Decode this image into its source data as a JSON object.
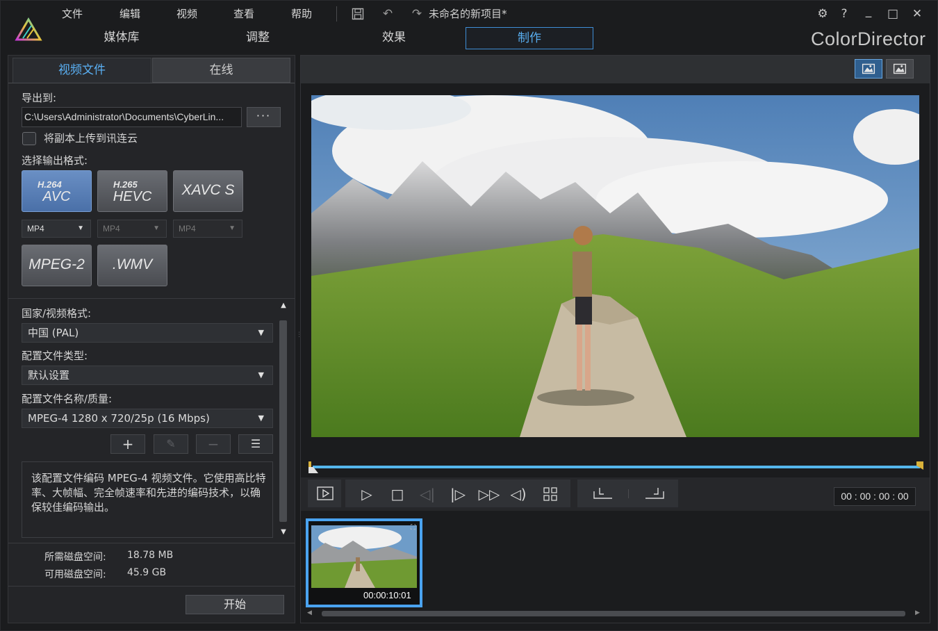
{
  "menu": [
    "文件",
    "编辑",
    "视频",
    "查看",
    "帮助"
  ],
  "project_title": "未命名的新项目*",
  "window_controls": {
    "settings": "⚙",
    "help": "?",
    "minimize": "_",
    "maximize": "□",
    "close": "✕"
  },
  "nav_tabs": [
    {
      "label": "媒体库",
      "active": false
    },
    {
      "label": "调整",
      "active": false
    },
    {
      "label": "效果",
      "active": false
    },
    {
      "label": "制作",
      "active": true
    }
  ],
  "brand": "ColorDirector",
  "left": {
    "subtabs": [
      {
        "label": "视频文件",
        "active": true
      },
      {
        "label": "在线",
        "active": false
      }
    ],
    "export_label": "导出到:",
    "export_path": "C:\\Users\\Administrator\\Documents\\CyberLin...",
    "browse_label": "···",
    "upload_label": "将副本上传到讯连云",
    "format_label": "选择输出格式:",
    "formats": [
      {
        "small": "H.264",
        "big": "AVC",
        "active": true
      },
      {
        "small": "H.265",
        "big": "HEVC",
        "active": false
      },
      {
        "small": "",
        "big": "XAVC S",
        "active": false
      },
      {
        "small": "",
        "big": "MPEG-2",
        "active": false
      },
      {
        "small": "",
        "big": ".WMV",
        "active": false
      }
    ],
    "containers": [
      "MP4",
      "MP4",
      "MP4"
    ],
    "country_label": "国家/视频格式:",
    "country_value": "中国 (PAL)",
    "profile_type_label": "配置文件类型:",
    "profile_type_value": "默认设置",
    "profile_name_label": "配置文件名称/质量:",
    "profile_name_value": "MPEG-4 1280 x 720/25p (16 Mbps)",
    "tools": [
      "+",
      "✎",
      "−",
      "☰"
    ],
    "description": "该配置文件编码 MPEG-4 视频文件。它使用高比特率、大帧幅、完全帧速率和先进的编码技术，以确保较佳编码输出。",
    "disk_required_label": "所需磁盘空间:",
    "disk_required_value": "18.78 MB",
    "disk_available_label": "可用磁盘空间:",
    "disk_available_value": "45.9 GB",
    "start_label": "开始"
  },
  "player": {
    "timecode": "00 : 00 : 00 : 00",
    "progress": 0
  },
  "clip": {
    "duration": "00:00:10:01"
  },
  "colors": {
    "accent": "#4aa3f0",
    "active_tab": "#58aef0",
    "format_active": "#5a80b8"
  }
}
